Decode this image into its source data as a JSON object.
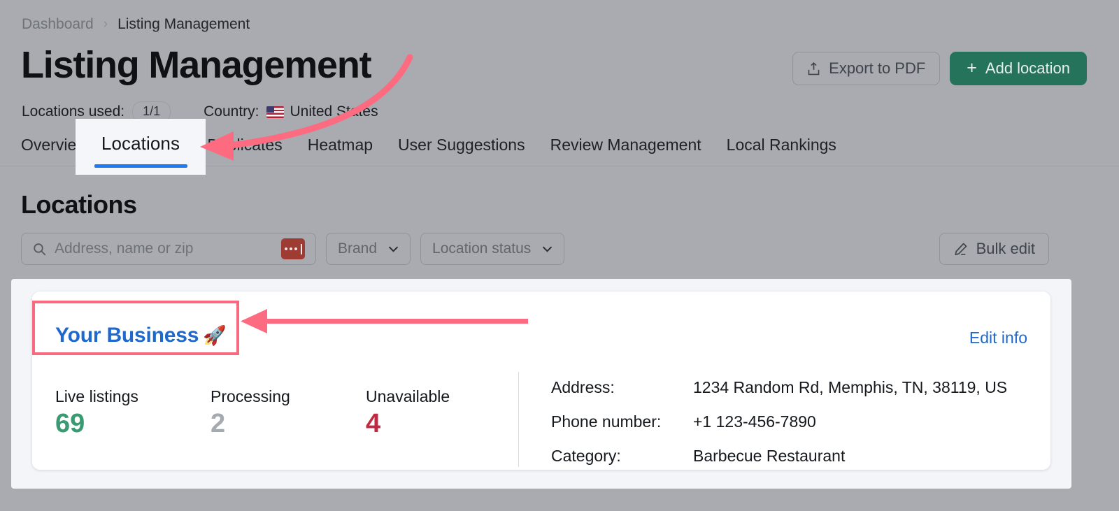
{
  "breadcrumb": {
    "parent": "Dashboard",
    "separator": "›",
    "current": "Listing Management"
  },
  "header": {
    "title": "Listing Management",
    "locations_used_label": "Locations used:",
    "locations_used_value": "1/1",
    "country_label": "Country:",
    "country_value": "United States",
    "flag_icon": "us-flag-icon"
  },
  "actions": {
    "export_label": "Export to PDF",
    "export_icon": "upload-icon",
    "add_location_label": "Add location",
    "add_location_icon": "plus-icon",
    "primary_color": "#24735a"
  },
  "tabs": [
    {
      "label": "Overview",
      "active": false
    },
    {
      "label": "Locations",
      "active": true
    },
    {
      "label": "Duplicates",
      "active": false
    },
    {
      "label": "Heatmap",
      "active": false
    },
    {
      "label": "User Suggestions",
      "active": false
    },
    {
      "label": "Review Management",
      "active": false
    },
    {
      "label": "Local Rankings",
      "active": false
    }
  ],
  "highlight": {
    "tab_label": "Locations",
    "underline_color": "#1d7af3",
    "box_color": "#f9697f"
  },
  "section": {
    "title": "Locations"
  },
  "filters": {
    "search_placeholder": "Address, name or zip",
    "search_icon": "search-icon",
    "redacted_icon": "redacted-text-icon",
    "brand_label": "Brand",
    "status_label": "Location status",
    "chevron_icon": "chevron-down-icon",
    "bulk_edit_label": "Bulk edit",
    "bulk_edit_icon": "pencil-icon"
  },
  "location_card": {
    "name": "Your Business",
    "emoji": "🚀",
    "edit_link": "Edit info",
    "stats": [
      {
        "label": "Live listings",
        "value": "69",
        "color": "#3a9a72"
      },
      {
        "label": "Processing",
        "value": "2",
        "color": "#a5a9b0"
      },
      {
        "label": "Unavailable",
        "value": "4",
        "color": "#c02942"
      }
    ],
    "details": [
      {
        "label": "Address:",
        "value": "1234 Random Rd, Memphis, TN, 38119, US"
      },
      {
        "label": "Phone number:",
        "value": "+1 123-456-7890"
      },
      {
        "label": "Category:",
        "value": "Barbecue Restaurant"
      }
    ]
  }
}
